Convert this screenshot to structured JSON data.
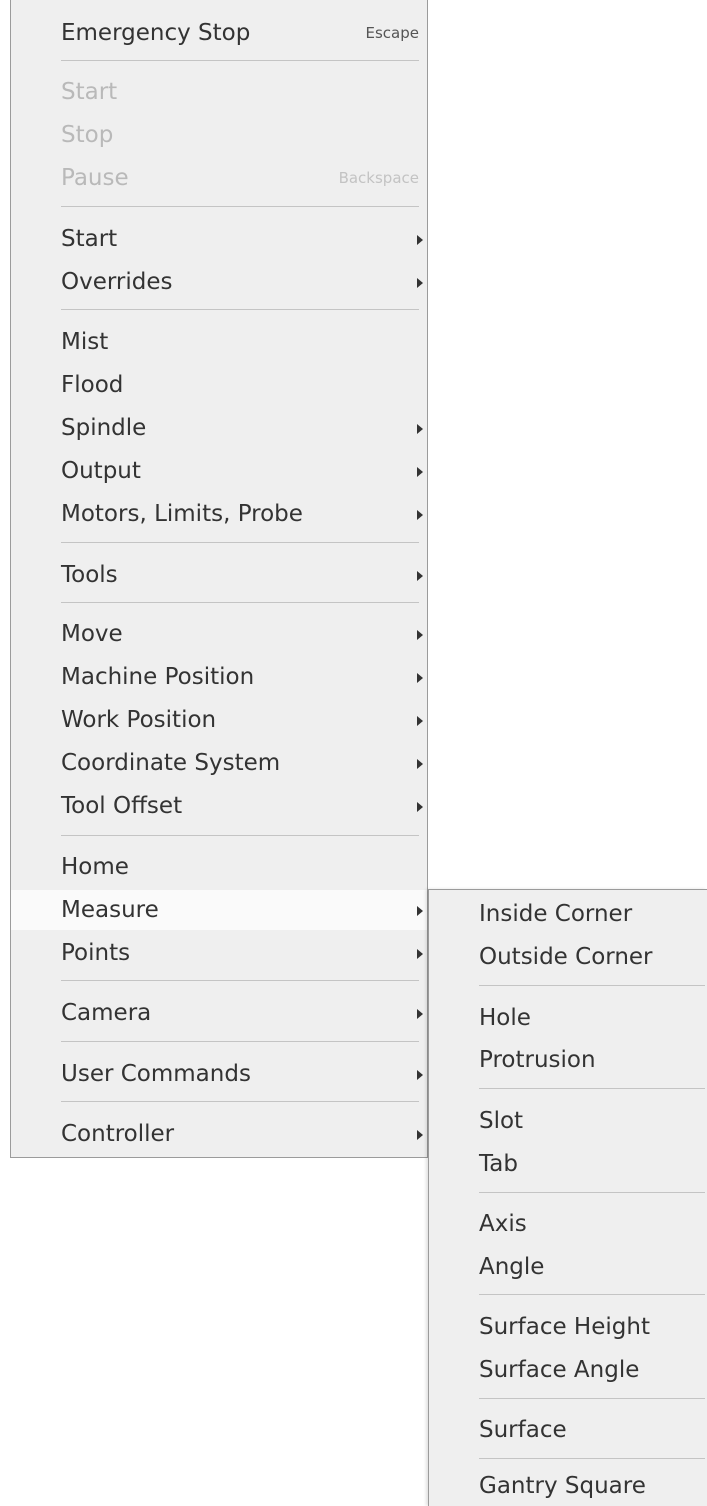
{
  "main_menu": {
    "emergency_stop": {
      "label": "Emergency Stop",
      "shortcut": "Escape"
    },
    "run_start": {
      "label": "Start"
    },
    "run_stop": {
      "label": "Stop"
    },
    "run_pause": {
      "label": "Pause",
      "shortcut": "Backspace"
    },
    "start": {
      "label": "Start"
    },
    "overrides": {
      "label": "Overrides"
    },
    "mist": {
      "label": "Mist"
    },
    "flood": {
      "label": "Flood"
    },
    "spindle": {
      "label": "Spindle"
    },
    "output": {
      "label": "Output"
    },
    "motors": {
      "label": "Motors, Limits, Probe"
    },
    "tools": {
      "label": "Tools"
    },
    "move": {
      "label": "Move"
    },
    "machine_position": {
      "label": "Machine Position"
    },
    "work_position": {
      "label": "Work Position"
    },
    "coordinate_system": {
      "label": "Coordinate System"
    },
    "tool_offset": {
      "label": "Tool Offset"
    },
    "home": {
      "label": "Home"
    },
    "measure": {
      "label": "Measure"
    },
    "points": {
      "label": "Points"
    },
    "camera": {
      "label": "Camera"
    },
    "user_commands": {
      "label": "User Commands"
    },
    "controller": {
      "label": "Controller"
    }
  },
  "measure_submenu": {
    "inside_corner": "Inside Corner",
    "outside_corner": "Outside Corner",
    "hole": "Hole",
    "protrusion": "Protrusion",
    "slot": "Slot",
    "tab": "Tab",
    "axis": "Axis",
    "angle": "Angle",
    "surface_height": "Surface Height",
    "surface_angle": "Surface Angle",
    "surface": "Surface",
    "gantry_square": "Gantry Square"
  },
  "colors": {
    "menu_background": "#efefef",
    "highlight_background": "#fafafa",
    "text": "#333333",
    "disabled_text": "#b9b9b9",
    "separator": "#c4c4c4",
    "border": "#9b9b9b"
  },
  "state": {
    "highlighted_item": "Measure",
    "disabled_items": [
      "Start",
      "Stop",
      "Pause"
    ]
  }
}
